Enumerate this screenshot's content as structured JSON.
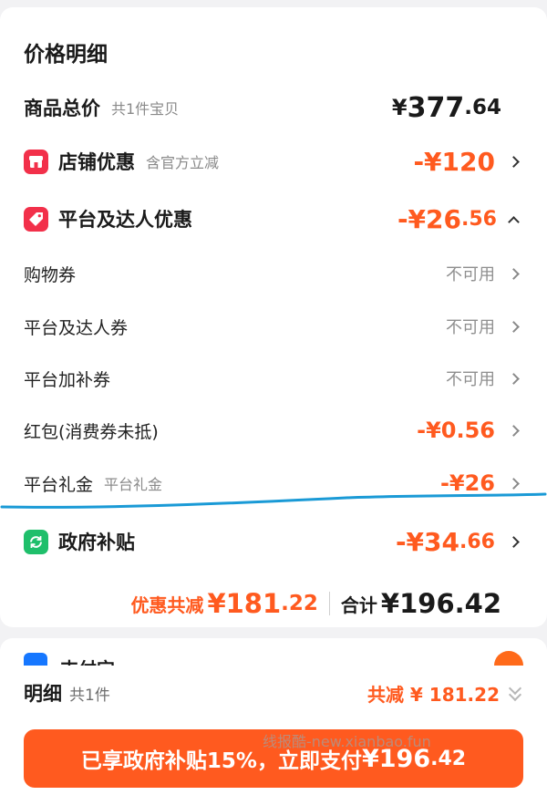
{
  "title": "价格明细",
  "total": {
    "label": "商品总价",
    "sub": "共1件宝贝",
    "symbol": "¥",
    "int": "377",
    "dec": ".64"
  },
  "store_discount": {
    "label": "店铺优惠",
    "sub": "含官方立减",
    "amount": "-¥120",
    "icon": "store-icon"
  },
  "platform_discount": {
    "label": "平台及达人优惠",
    "amount_int": "-¥26",
    "amount_dec": ".56",
    "icon": "tag-icon"
  },
  "items": [
    {
      "label": "购物券",
      "value": "不可用"
    },
    {
      "label": "平台及达人券",
      "value": "不可用"
    },
    {
      "label": "平台加补券",
      "value": "不可用"
    },
    {
      "label": "红包(消费券未抵)",
      "value": "-¥0.56"
    },
    {
      "label": "平台礼金",
      "sub": "平台礼金",
      "value": "-¥26"
    }
  ],
  "gov_subsidy": {
    "label": "政府补贴",
    "amount_int": "-¥34",
    "amount_dec": ".66",
    "icon": "refresh-icon"
  },
  "summary": {
    "discount_label": "优惠共减",
    "discount_int": "¥181",
    "discount_dec": ".22",
    "total_label": "合计",
    "total_int": "¥196",
    "total_dec": ".42"
  },
  "next_section": {
    "label": "支付宝"
  },
  "detail": {
    "title": "明细",
    "count": "共1件",
    "amount": "共减 ¥ 181.22"
  },
  "pay_button": {
    "prefix": "已享政府补贴15%，立即支付",
    "int": "¥196",
    "dec": ".42"
  },
  "watermark": "线报酷-new.xianbao.fun",
  "colors": {
    "accent": "#ff5a1f",
    "store_icon": "#f2304a",
    "gov_icon": "#1fbf6b",
    "annotation_line": "#1a9ad6"
  }
}
